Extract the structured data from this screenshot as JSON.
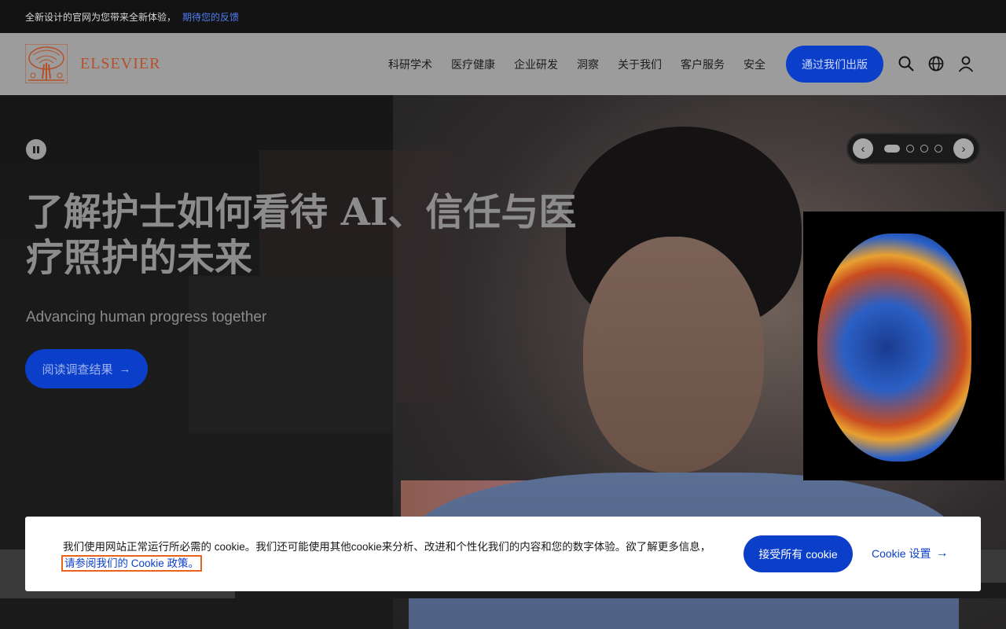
{
  "topbar": {
    "text": "全新设计的官网为您带来全新体验，",
    "link": "期待您的反馈"
  },
  "header": {
    "logo_text": "ELSEVIER",
    "nav": [
      "科研学术",
      "医疗健康",
      "企业研发",
      "洞察",
      "关于我们",
      "客户服务",
      "安全"
    ],
    "publish_label": "通过我们出版",
    "icons": [
      "search-icon",
      "globe-icon",
      "user-icon"
    ]
  },
  "hero": {
    "title": "了解护士如何看待 AI、信任与医疗照护的未来",
    "subtitle": "Advancing human progress together",
    "cta_label": "阅读调查结果",
    "carousel": {
      "slides": 4,
      "active": 1
    }
  },
  "cookie": {
    "text": "我们使用网站正常运行所必需的 cookie。我们还可能使用其他cookie来分析、改进和个性化我们的内容和您的数字体验。欲了解更多信息，",
    "link": "请参阅我们的 Cookie 政策。",
    "accept_label": "接受所有 cookie",
    "settings_label": "Cookie 设置"
  },
  "colors": {
    "brand_blue": "#0c3fc9",
    "logo_orange": "#b5502a"
  }
}
